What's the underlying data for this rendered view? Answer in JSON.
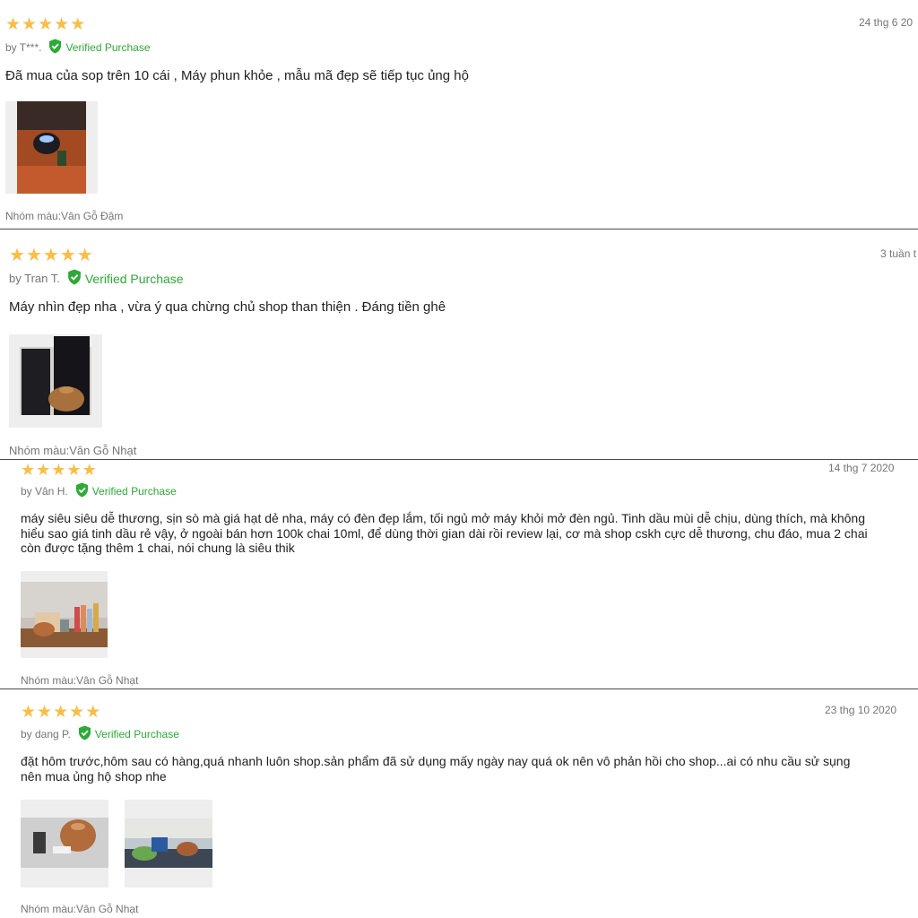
{
  "verified_label": "Verified Purchase",
  "colors": {
    "star": "#fcbd44",
    "verified": "#2daa37",
    "muted": "#757575",
    "text": "#212121"
  },
  "reviews": [
    {
      "rating": 5,
      "date": "24 thg 6 20",
      "author": "by T***.",
      "comment_lines": [
        "Đã mua của sop trên 10 cái , Máy phun khỏe , mẫu mã đẹp sẽ tiếp tục ủng hộ"
      ],
      "images": [
        "photo-diffuser-lit-on-red-carpet"
      ],
      "meta": "Nhóm màu:Vân Gỗ Đậm"
    },
    {
      "rating": 5,
      "date": "3 tuần t",
      "author": "by Tran T.",
      "comment_lines": [
        "Máy nhìn đẹp nha , vừa ý qua chừng chủ shop than thiện . Đáng tiền ghê"
      ],
      "images": [
        "photo-diffuser-between-speakers"
      ],
      "meta": "Nhóm màu:Vân Gỗ Nhạt"
    },
    {
      "rating": 5,
      "date": "14 thg 7 2020",
      "author": "by Vân H.",
      "comment_lines": [
        "máy siêu siêu dễ thương, sịn sò mà giá hạt dẻ nha, máy có đèn đẹp lắm, tối ngủ mở máy khỏi mở đèn ngủ. Tinh dầu mùi dễ chịu, dùng thích, mà không",
        "hiểu sao giá tinh dầu rẻ vậy, ở ngoài bán hơn 100k chai 10ml, để dùng thời gian dài rồi review lại, cơ mà shop cskh cực dễ thương, chu đáo, mua 2 chai",
        "còn được tặng thêm 1 chai, nói chung là siêu thik"
      ],
      "images": [
        "photo-diffuser-on-shelf"
      ],
      "meta": "Nhóm màu:Vân Gỗ Nhạt"
    },
    {
      "rating": 5,
      "date": "23 thg 10 2020",
      "author": "by dang P.",
      "comment_lines": [
        "đặt hôm trước,hôm sau có hàng,quá nhanh luôn shop.sản phẩm đã sử dụng mấy ngày nay quá ok nên vô phản hồi cho shop...ai có nhu cầu sử sụng",
        "nên mua ủng hộ shop nhe"
      ],
      "images": [
        "photo-diffuser-with-remote",
        "photo-diffuser-on-desk"
      ],
      "meta": "Nhóm màu:Vân Gỗ Nhạt"
    }
  ]
}
